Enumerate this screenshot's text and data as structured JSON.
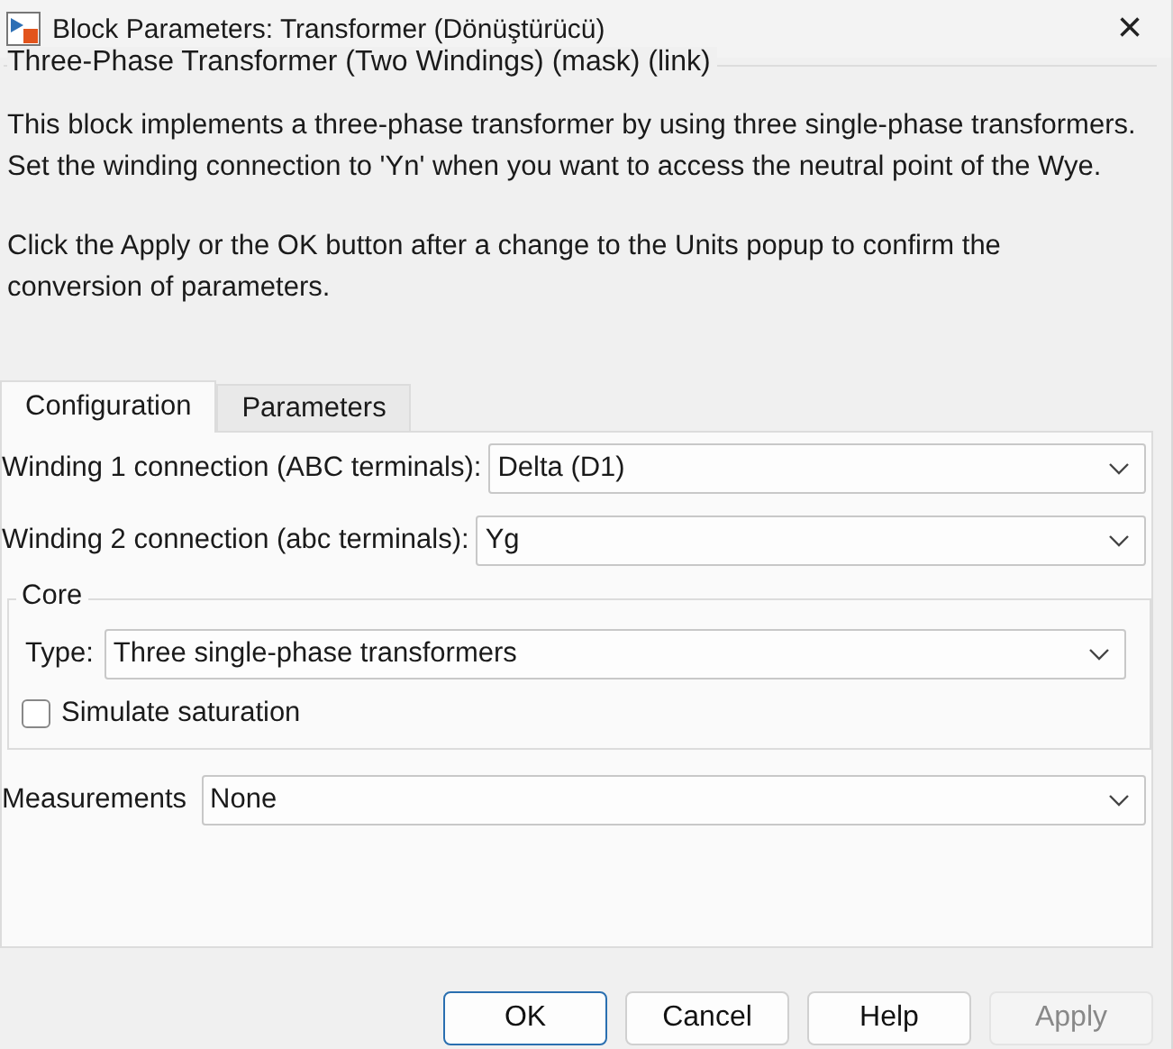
{
  "window": {
    "title": "Block Parameters: Transformer (Dönüştürücü)",
    "close": "×"
  },
  "mask": {
    "title": "Three-Phase Transformer (Two Windings) (mask) (link)",
    "paragraphs": [
      "This block implements a three-phase transformer by using three single-phase transformers. Set the winding connection to 'Yn'  when you want to access the neutral point of the Wye.",
      "Click the Apply or the OK button after a change to the Units popup to confirm the conversion of parameters."
    ]
  },
  "tabs": [
    {
      "label": "Configuration",
      "selected": true
    },
    {
      "label": "Parameters",
      "selected": false
    }
  ],
  "fields": [
    {
      "label": "Winding 1 connection (ABC terminals):",
      "value": "Delta (D1)"
    },
    {
      "label": "Winding 2 connection (abc terminals):",
      "value": "Yg"
    }
  ],
  "core": {
    "title": "Core",
    "type": {
      "label": "Type:",
      "value": "Three single-phase transformers"
    },
    "saturation": {
      "label": "Simulate saturation",
      "checked": false
    }
  },
  "measurements": {
    "label": "Measurements",
    "value": "None"
  },
  "buttons": [
    {
      "label": "OK",
      "default": true,
      "disabled": false
    },
    {
      "label": "Cancel",
      "default": false,
      "disabled": false
    },
    {
      "label": "Help",
      "default": false,
      "disabled": false
    },
    {
      "label": "Apply",
      "default": false,
      "disabled": true
    }
  ]
}
